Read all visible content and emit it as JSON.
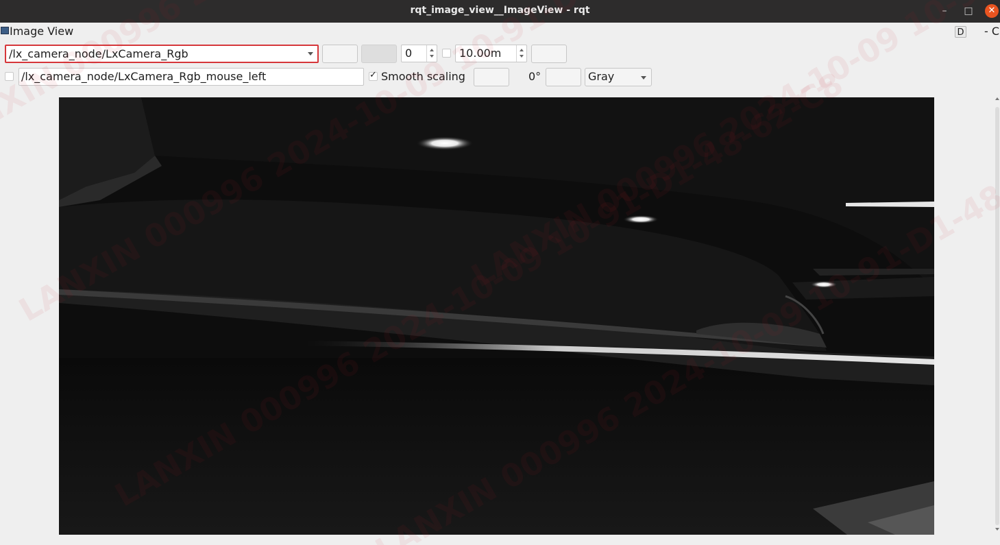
{
  "window": {
    "title": "rqt_image_view__ImageView - rqt",
    "minimize_glyph": "–",
    "maximize_glyph": "□",
    "close_glyph": "✕"
  },
  "dock": {
    "title": "Image View",
    "d_button": "D",
    "close_label": "- C"
  },
  "toolbar": {
    "topic": "/lx_camera_node/LxCamera_Rgb",
    "num_gridlines": "0",
    "max_depth": "10.00m",
    "max_depth_checked": false
  },
  "mouse": {
    "enabled": false,
    "topic": "/lx_camera_node/LxCamera_Rgb_mouse_left"
  },
  "view": {
    "smooth_scaling_label": "Smooth scaling",
    "smooth_scaling_checked": true,
    "rotation": "0°",
    "color_scheme": "Gray"
  },
  "watermark": {
    "text": "LANXIN 000996 2024-10-09 10-91-D1-48-62-C8",
    "color": "#c4202a"
  },
  "colors": {
    "titlebar": "#2d2c2c",
    "accent_close": "#e95420",
    "highlight_border": "#d6363a"
  }
}
